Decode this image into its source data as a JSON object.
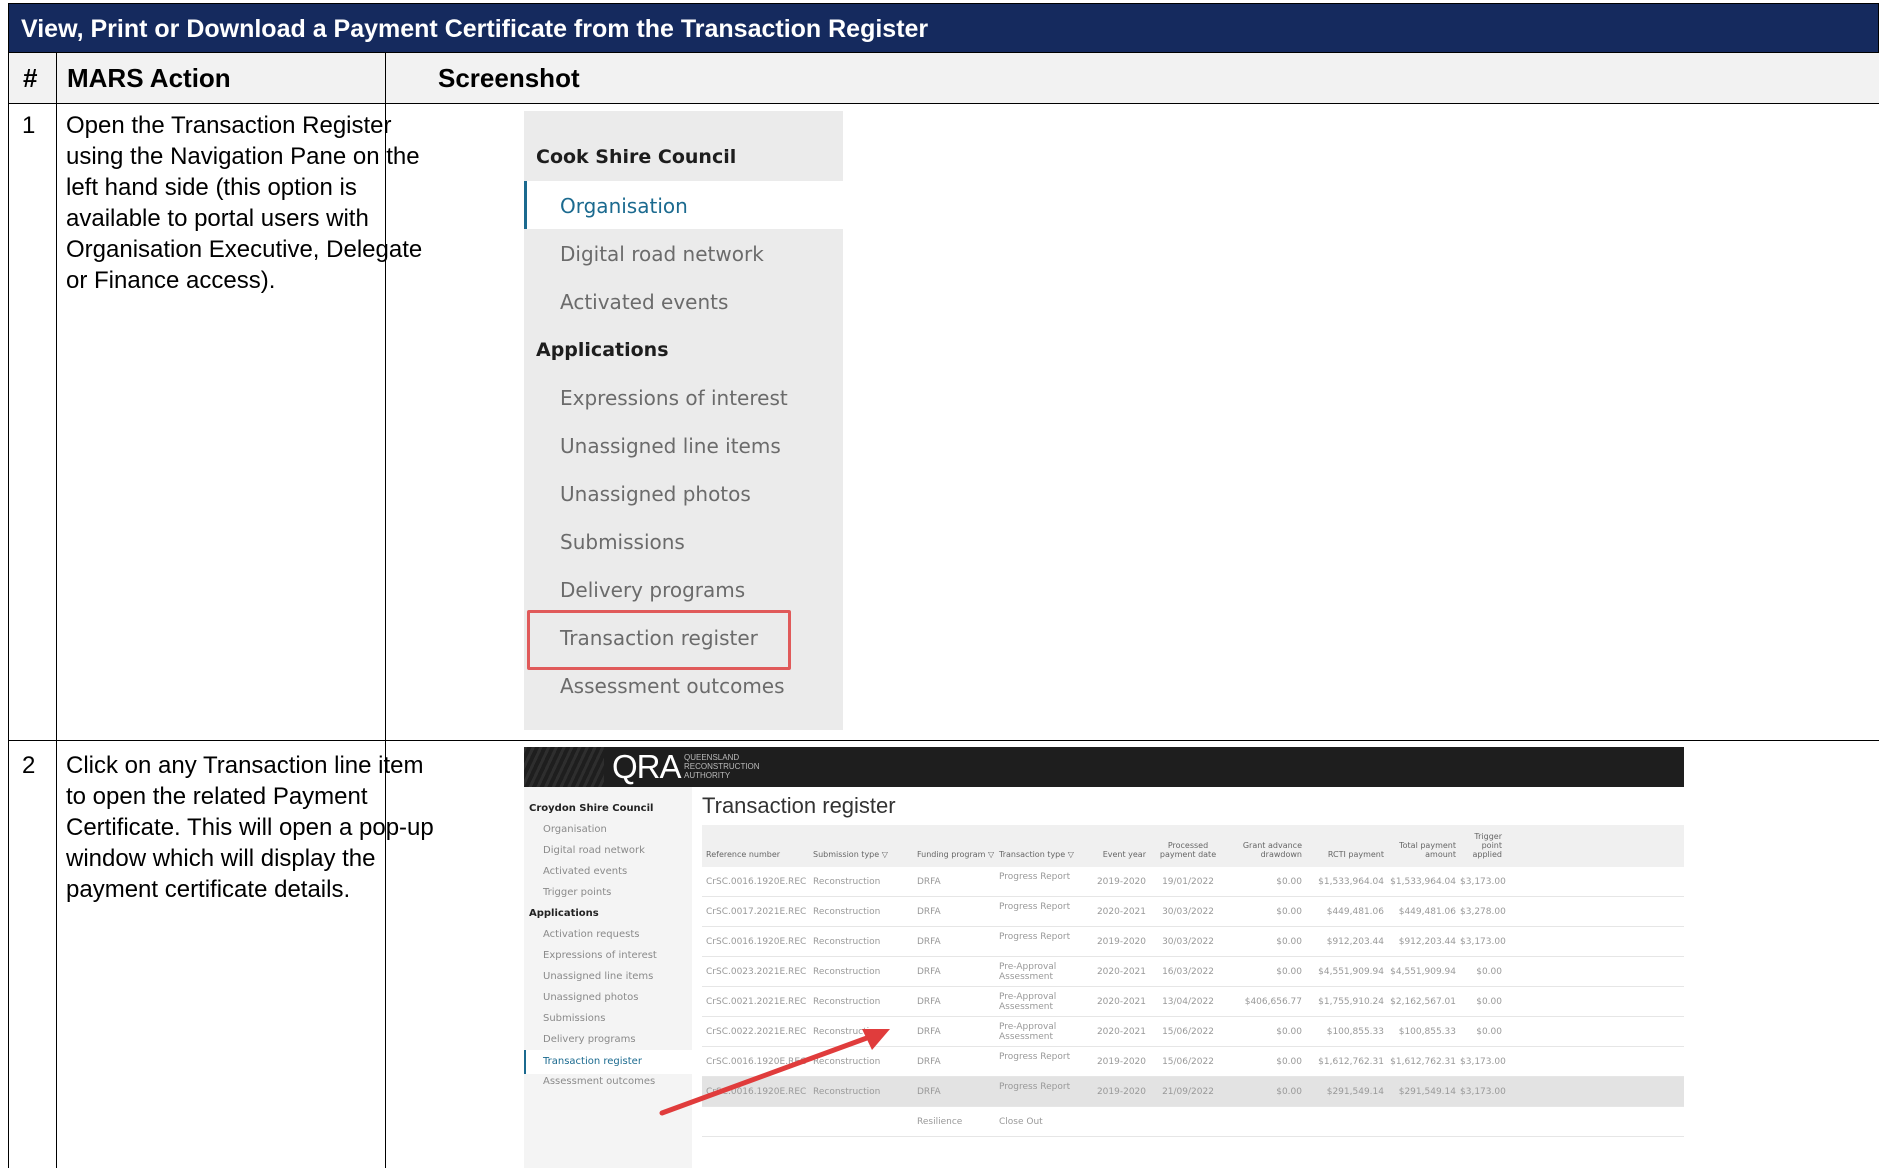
{
  "document": {
    "title": "View, Print or Download a Payment Certificate from the Transaction Register",
    "headers": {
      "num": "#",
      "action": "MARS Action",
      "screenshot": "Screenshot"
    },
    "steps": [
      {
        "num": "1",
        "text": "Open the Transaction Register using the Navigation Pane on the left hand side (this option is available to portal users with Organisation Executive, Delegate or Finance access)."
      },
      {
        "num": "2",
        "text": "Click on any Transaction line item to open the related Payment Certificate.  This will open a pop-up window which will display the payment certificate details."
      }
    ]
  },
  "nav_screenshot": {
    "org": "Cook Shire Council",
    "active": "Organisation",
    "items_top": [
      "Digital road network",
      "Activated events"
    ],
    "section": "Applications",
    "items": [
      "Expressions of interest",
      "Unassigned line items",
      "Unassigned photos",
      "Submissions",
      "Delivery programs",
      "Transaction register",
      "Assessment outcomes"
    ],
    "highlight_color": "#e05a5a",
    "accent_color": "#1b6a8f"
  },
  "register_screenshot": {
    "logo": "QRA",
    "logo_sub": [
      "QUEENSLAND",
      "RECONSTRUCTION",
      "AUTHORITY"
    ],
    "org": "Croydon Shire Council",
    "side_items": [
      "Organisation",
      "Digital road network",
      "Activated events",
      "Trigger points"
    ],
    "side_section": "Applications",
    "side_items2": [
      "Activation requests",
      "Expressions of interest",
      "Unassigned line items",
      "Unassigned photos",
      "Submissions",
      "Delivery programs"
    ],
    "side_active": "Transaction register",
    "side_last": "Assessment outcomes",
    "title": "Transaction register",
    "columns": [
      "Reference number",
      "Submission type ▽",
      "Funding program ▽",
      "Transaction type ▽",
      "Event year",
      "Processed payment date",
      "Grant advance drawdown",
      "RCTI payment",
      "Total payment amount",
      "Trigger point applied"
    ],
    "rows": [
      [
        "CrSC.0016.1920E.REC",
        "Reconstruction",
        "DRFA",
        "Progress Report",
        "2019-2020",
        "19/01/2022",
        "$0.00",
        "$1,533,964.04",
        "$1,533,964.04",
        "$3,173.00"
      ],
      [
        "CrSC.0017.2021E.REC",
        "Reconstruction",
        "DRFA",
        "Progress Report",
        "2020-2021",
        "30/03/2022",
        "$0.00",
        "$449,481.06",
        "$449,481.06",
        "$3,278.00"
      ],
      [
        "CrSC.0016.1920E.REC",
        "Reconstruction",
        "DRFA",
        "Progress Report",
        "2019-2020",
        "30/03/2022",
        "$0.00",
        "$912,203.44",
        "$912,203.44",
        "$3,173.00"
      ],
      [
        "CrSC.0023.2021E.REC",
        "Reconstruction",
        "DRFA",
        "Pre-Approval Assessment",
        "2020-2021",
        "16/03/2022",
        "$0.00",
        "$4,551,909.94",
        "$4,551,909.94",
        "$0.00"
      ],
      [
        "CrSC.0021.2021E.REC",
        "Reconstruction",
        "DRFA",
        "Pre-Approval Assessment",
        "2020-2021",
        "13/04/2022",
        "$406,656.77",
        "$1,755,910.24",
        "$2,162,567.01",
        "$0.00"
      ],
      [
        "CrSC.0022.2021E.REC",
        "Reconstruction",
        "DRFA",
        "Pre-Approval Assessment",
        "2020-2021",
        "15/06/2022",
        "$0.00",
        "$100,855.33",
        "$100,855.33",
        "$0.00"
      ],
      [
        "CrSC.0016.1920E.REC",
        "Reconstruction",
        "DRFA",
        "Progress Report",
        "2019-2020",
        "15/06/2022",
        "$0.00",
        "$1,612,762.31",
        "$1,612,762.31",
        "$3,173.00"
      ],
      [
        "CrSC.0016.1920E.REC",
        "Reconstruction",
        "DRFA",
        "Progress Report",
        "2019-2020",
        "21/09/2022",
        "$0.00",
        "$291,549.14",
        "$291,549.14",
        "$3,173.00"
      ],
      [
        "",
        "",
        "Resilience",
        "Close Out",
        "",
        "",
        "",
        "",
        "",
        ""
      ]
    ],
    "selected_row": 7,
    "arrow_color": "#e03c3c"
  }
}
